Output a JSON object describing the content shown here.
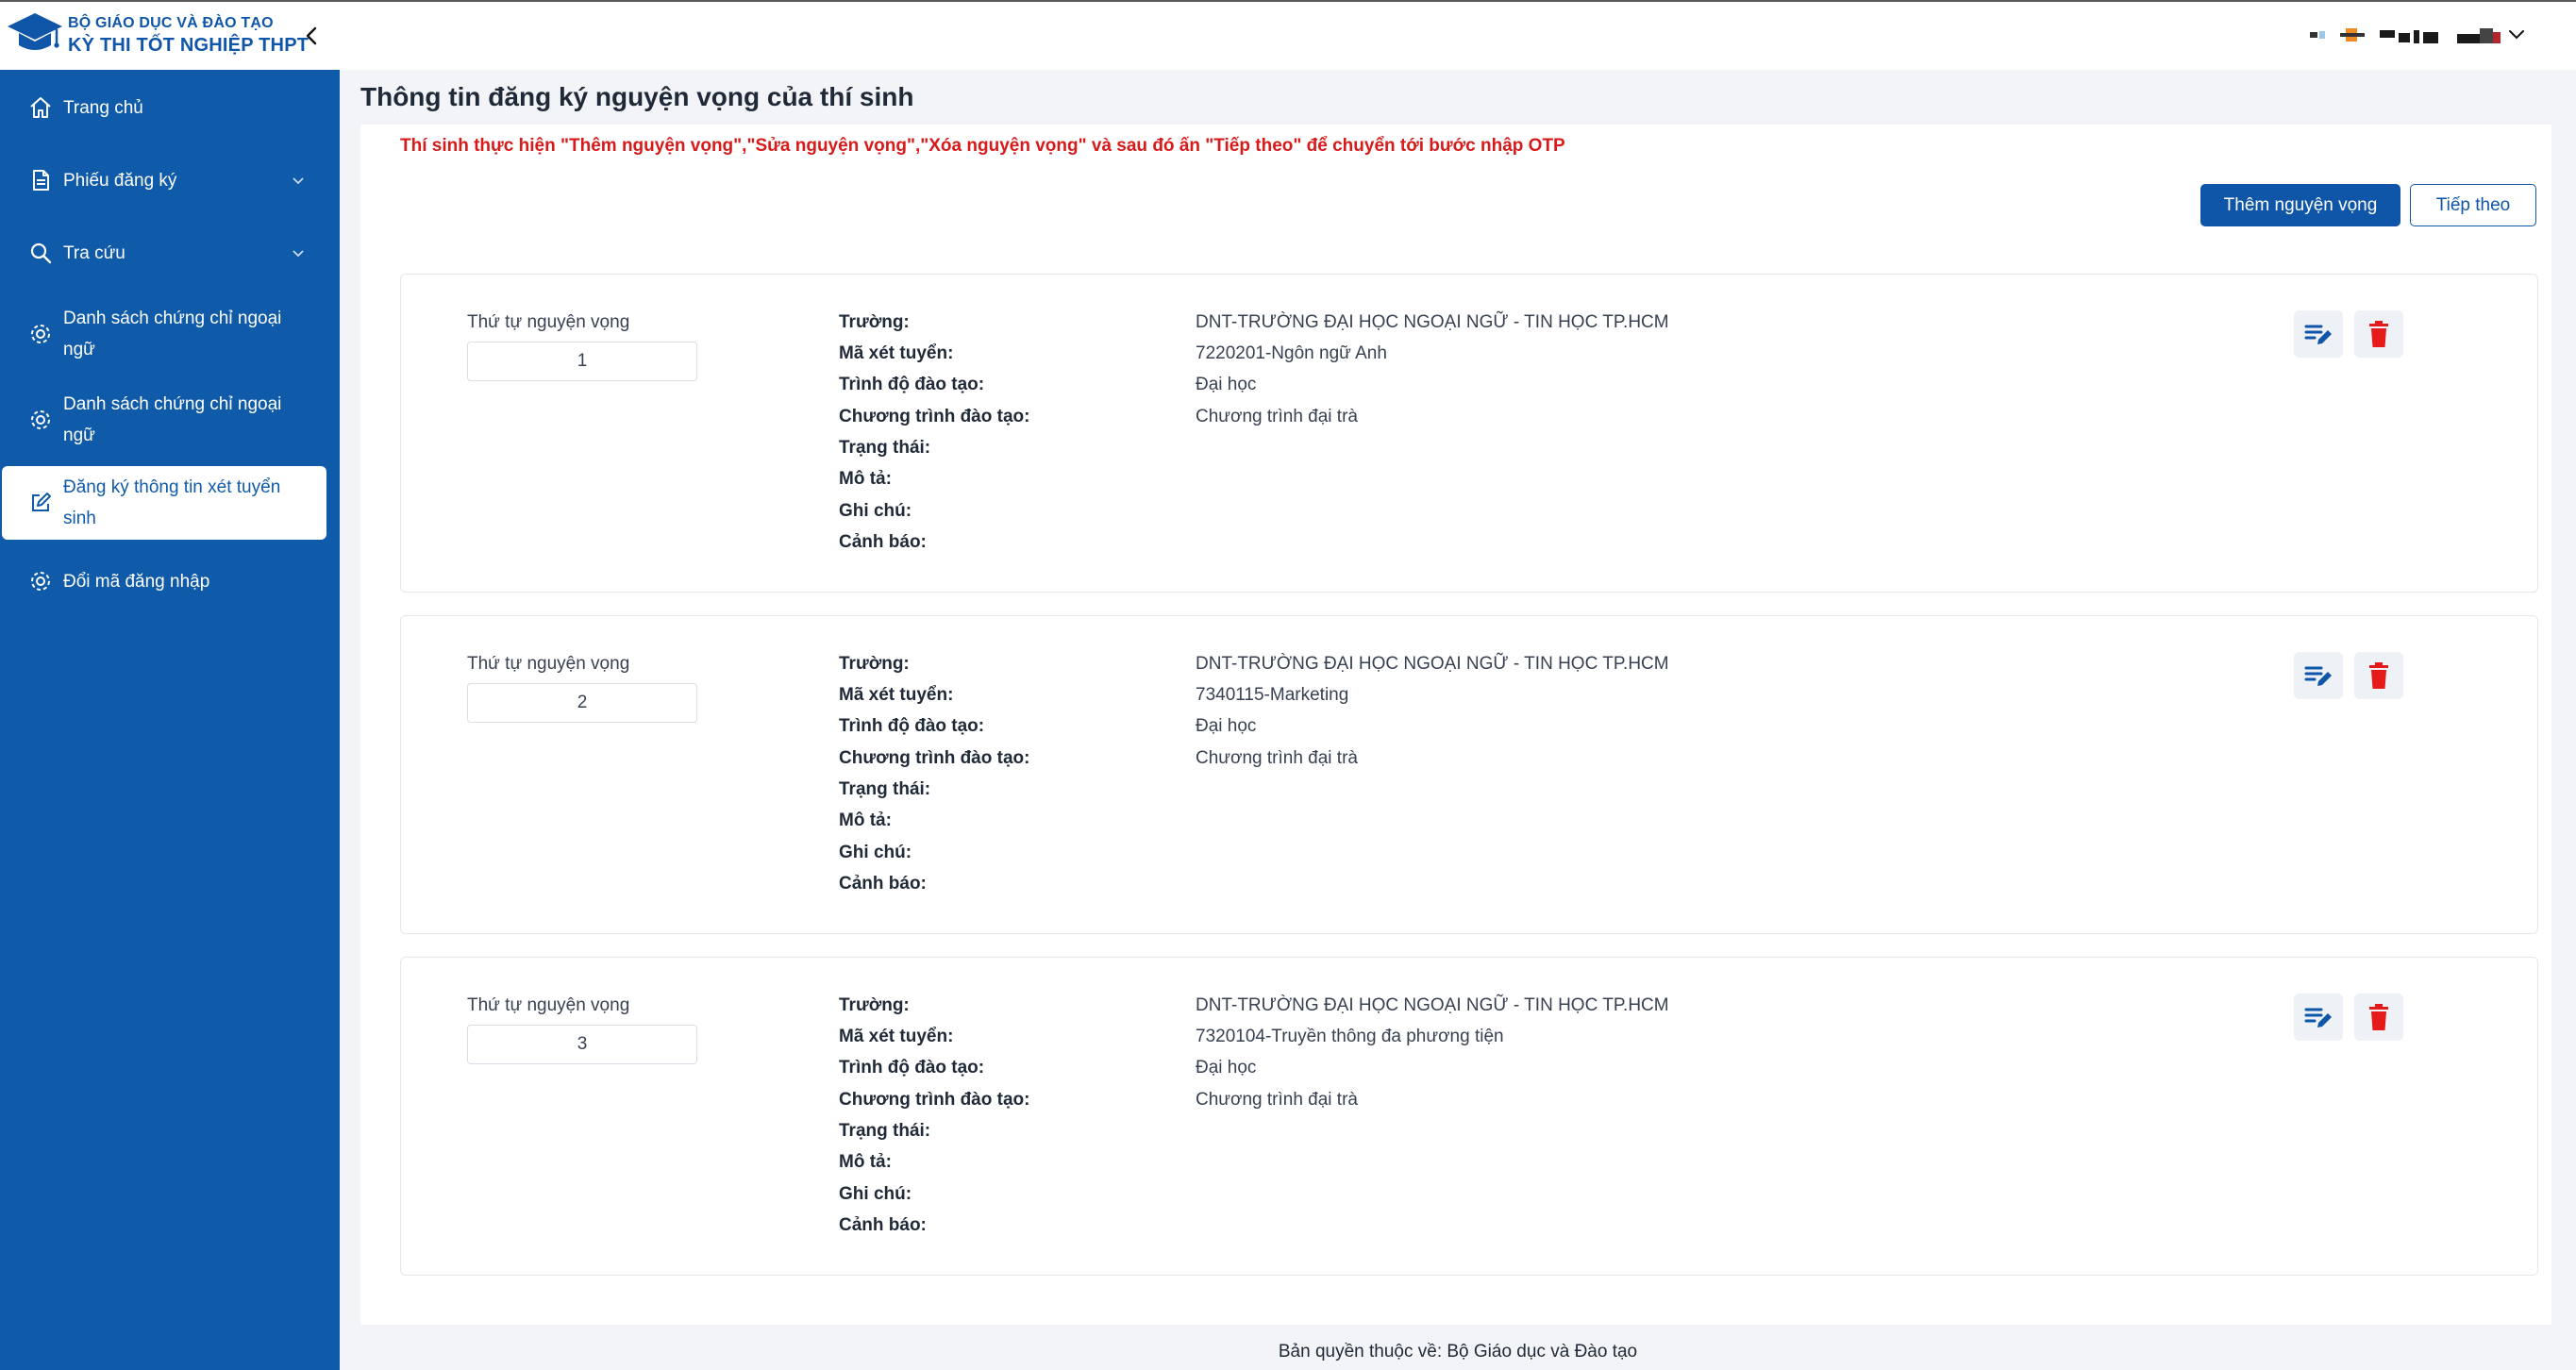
{
  "header": {
    "org": "BỘ GIÁO DỤC VÀ ĐÀO TẠO",
    "exam": "KỲ THI TỐT NGHIỆP THPT",
    "collapse_icon": "chevron-left-icon",
    "user_icon": "chevron-down-icon"
  },
  "sidebar": {
    "items": [
      {
        "label": "Trang chủ",
        "icon": "home-icon"
      },
      {
        "label": "Phiếu đăng ký",
        "icon": "document-icon"
      },
      {
        "label": "Tra cứu",
        "icon": "search-icon"
      },
      {
        "label": "Danh sách chứng chỉ ngoại ngữ",
        "icon": "gear-icon"
      },
      {
        "label": "Danh sách chứng chỉ ngoại ngữ",
        "icon": "gear-icon"
      },
      {
        "label": "Đăng ký thông tin xét tuyển sinh",
        "icon": "edit-icon"
      },
      {
        "label": "Đổi mã đăng nhập",
        "icon": "gear-icon"
      }
    ]
  },
  "main": {
    "title": "Thông tin đăng ký nguyện vọng của thí sinh",
    "notice": "Thí sinh thực hiện \"Thêm nguyện vọng\",\"Sửa nguyện vọng\",\"Xóa nguyện vọng\" và sau đó ấn \"Tiếp theo\" để chuyển tới bước nhập OTP",
    "add_button": "Thêm nguyện vọng",
    "next_button": "Tiếp theo",
    "order_label": "Thứ tự nguyện vọng",
    "field_labels": {
      "school": "Trường:",
      "code": "Mã xét tuyển:",
      "level": "Trình độ đào tạo:",
      "program": "Chương trình đào tạo:",
      "status": "Trạng thái:",
      "description": "Mô tả:",
      "note": "Ghi chú:",
      "warning": "Cảnh báo:"
    },
    "wishes": [
      {
        "order": "1",
        "school": "DNT-TRƯỜNG ĐẠI HỌC NGOẠI NGỮ - TIN HỌC TP.HCM",
        "code": "7220201-Ngôn ngữ Anh",
        "level": "Đại học",
        "program": "Chương trình đại trà",
        "status": "",
        "description": "",
        "note": "",
        "warning": ""
      },
      {
        "order": "2",
        "school": "DNT-TRƯỜNG ĐẠI HỌC NGOẠI NGỮ - TIN HỌC TP.HCM",
        "code": "7340115-Marketing",
        "level": "Đại học",
        "program": "Chương trình đại trà",
        "status": "",
        "description": "",
        "note": "",
        "warning": ""
      },
      {
        "order": "3",
        "school": "DNT-TRƯỜNG ĐẠI HỌC NGOẠI NGỮ - TIN HỌC TP.HCM",
        "code": "7320104-Truyền thông đa phương tiện",
        "level": "Đại học",
        "program": "Chương trình đại trà",
        "status": "",
        "description": "",
        "note": "",
        "warning": ""
      }
    ]
  },
  "footer": {
    "copyright": "Bản quyền thuộc về: Bộ Giáo dục và Đào tạo"
  },
  "colors": {
    "brand": "#0f55a8",
    "sidebar": "#0f5aa9",
    "notice": "#d71a1a",
    "delete": "#e51b1b"
  }
}
